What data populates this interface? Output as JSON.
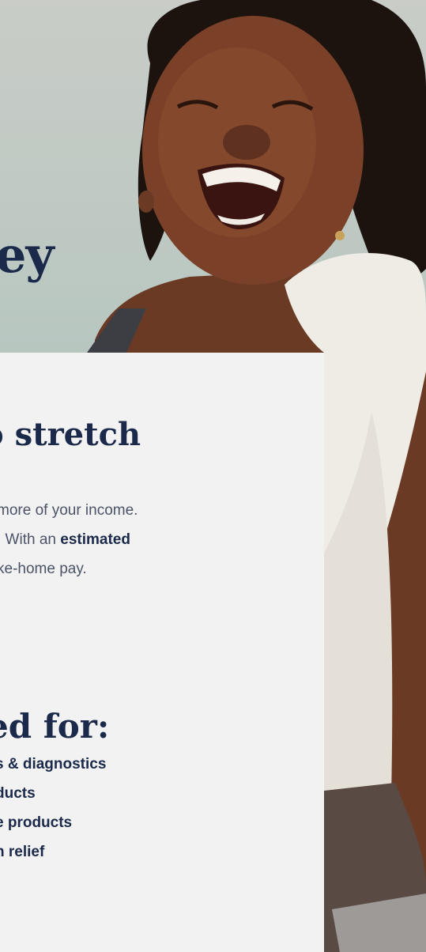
{
  "hero": {
    "headline": "ey"
  },
  "card": {
    "heading": "o stretch",
    "body_lines": [
      {
        "text": " more of your income.",
        "bold": ""
      },
      {
        "text": ". With an ",
        "bold": "estimated"
      },
      {
        "text": "ke-home pay.",
        "bold": ""
      }
    ],
    "eligible_heading": "ed for:",
    "eligible_items": [
      "s & diagnostics",
      "ducts",
      "e products",
      "n relief"
    ]
  },
  "colors": {
    "navy": "#1b2a4a",
    "body_gray": "#4b5368",
    "card_bg": "#f2f2f2"
  }
}
